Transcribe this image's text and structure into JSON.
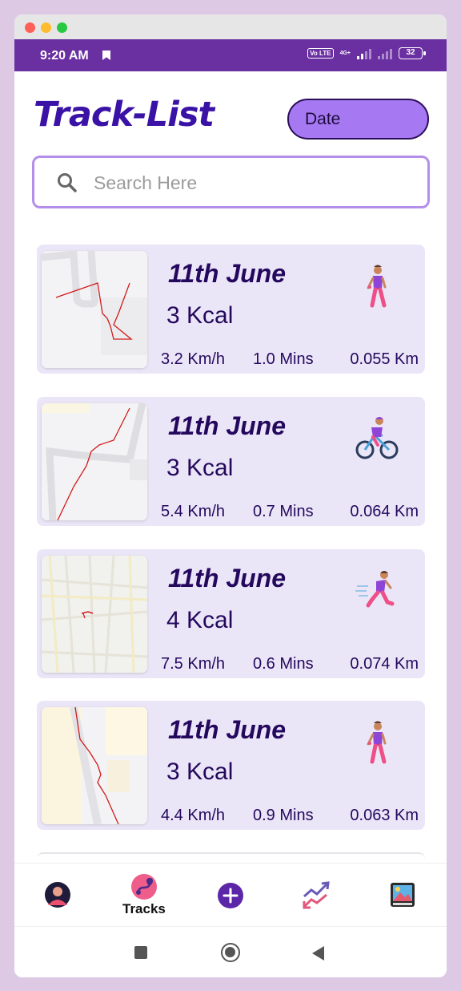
{
  "status": {
    "time": "9:20 AM",
    "volte": "Vo LTE",
    "network": "4G+",
    "battery": "32"
  },
  "header": {
    "title": "Track-List",
    "date_button": "Date"
  },
  "search": {
    "placeholder": "Search Here"
  },
  "tracks": [
    {
      "date": "11th June",
      "kcal": "3 Kcal",
      "speed": "3.2 Km/h",
      "duration": "1.0 Mins",
      "distance": "0.055 Km",
      "activity_icon": "walking-person-icon"
    },
    {
      "date": "11th June",
      "kcal": "3 Kcal",
      "speed": "5.4 Km/h",
      "duration": "0.7 Mins",
      "distance": "0.064 Km",
      "activity_icon": "cycling-person-icon"
    },
    {
      "date": "11th June",
      "kcal": "4 Kcal",
      "speed": "7.5 Km/h",
      "duration": "0.6 Mins",
      "distance": "0.074 Km",
      "activity_icon": "running-person-icon"
    },
    {
      "date": "11th June",
      "kcal": "3 Kcal",
      "speed": "4.4 Km/h",
      "duration": "0.9 Mins",
      "distance": "0.063 Km",
      "activity_icon": "walking-person-icon"
    }
  ],
  "bottom_nav": {
    "items": [
      {
        "name": "profile",
        "icon": "avatar-icon"
      },
      {
        "name": "tracks",
        "label": "Tracks",
        "icon": "route-icon",
        "active": true
      },
      {
        "name": "add",
        "icon": "plus-icon"
      },
      {
        "name": "stats",
        "icon": "trend-chart-icon"
      },
      {
        "name": "gallery",
        "icon": "picture-frame-icon"
      }
    ]
  },
  "colors": {
    "accent": "#6a2fa1",
    "title": "#3a12a6",
    "card_bg": "#ebe6f7",
    "date_button": "#a678f2",
    "route": "#d11a1a"
  }
}
